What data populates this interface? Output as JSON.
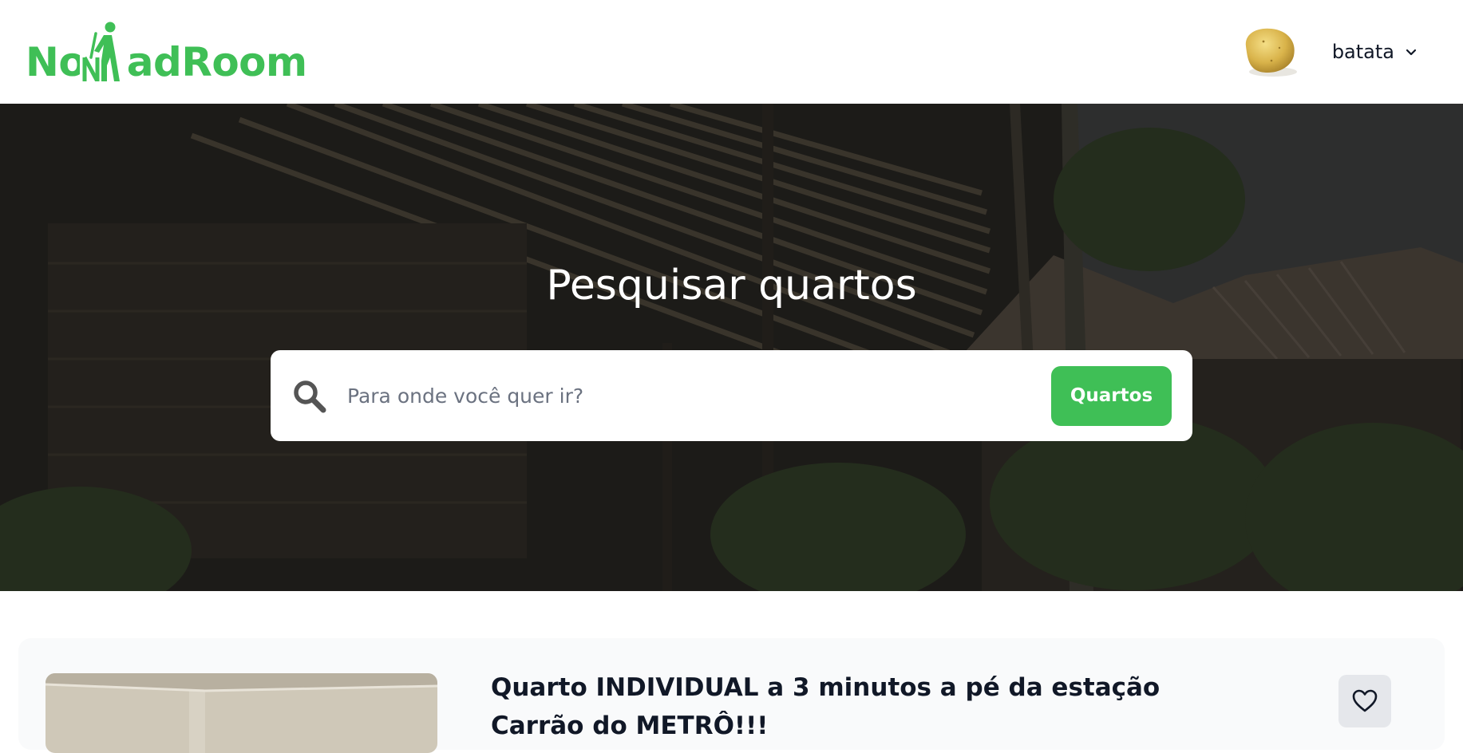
{
  "header": {
    "logo_text": "NomadRoom",
    "username": "batata"
  },
  "hero": {
    "title": "Pesquisar quartos"
  },
  "search": {
    "placeholder": "Para onde você quer ir?",
    "button_label": "Quartos"
  },
  "listing": {
    "title": "Quarto INDIVIDUAL a 3 minutos a pé da estação Carrão do METRÔ!!!"
  },
  "icons": {
    "search": "search-icon",
    "chevron": "chevron-down-icon",
    "favorite": "heart-icon"
  },
  "colors": {
    "brand_green": "#3fbf56",
    "hero_overlay": "#2b2a25"
  }
}
